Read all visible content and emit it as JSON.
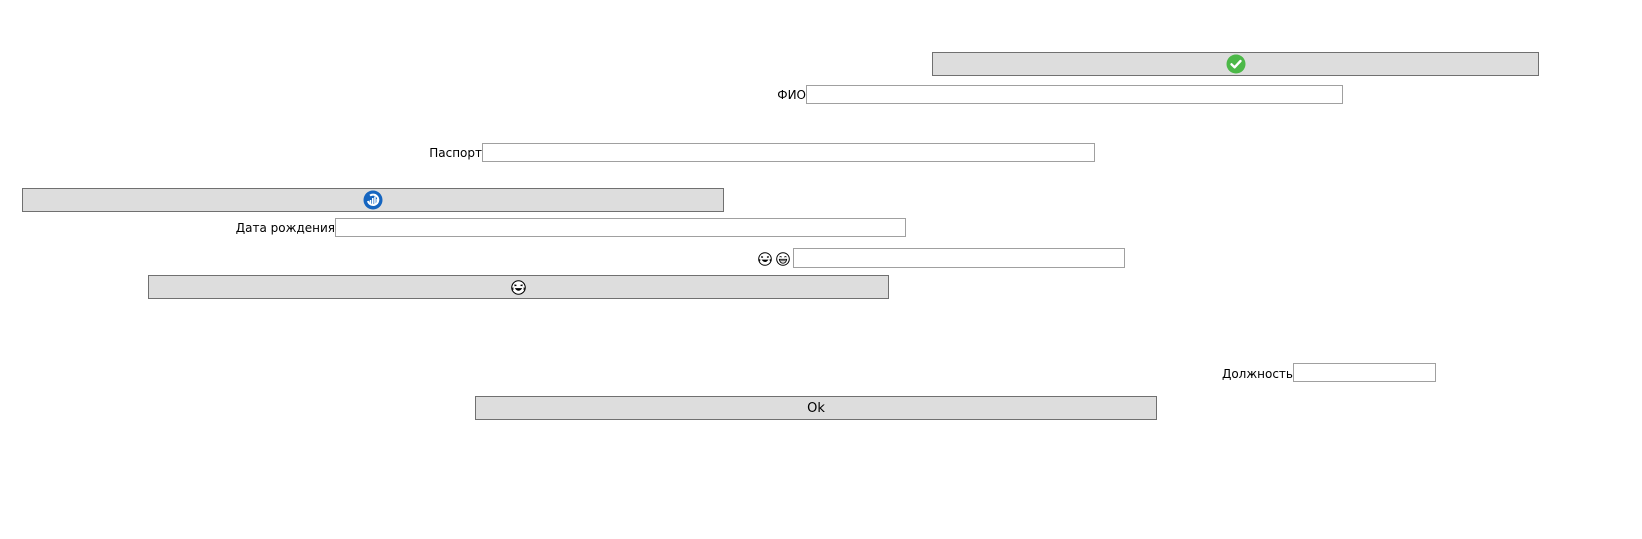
{
  "form": {
    "top_button": {
      "icon": "check-circle-icon",
      "icon_color": "#4cb848"
    },
    "fio": {
      "label": "ФИО",
      "value": ""
    },
    "passport": {
      "label": "Паспорт",
      "value": ""
    },
    "middle_button": {
      "icon": "refresh-circle-icon",
      "icon_color": "#1565c0"
    },
    "birth_date": {
      "label": "Дата рождения",
      "value": ""
    },
    "emoji_field": {
      "label_icons": [
        "laughing-face-icon",
        "grinning-face-icon"
      ],
      "value": ""
    },
    "emoji_button": {
      "icon": "laughing-face-icon"
    },
    "position": {
      "label": "Должность",
      "value": ""
    },
    "ok_button": {
      "label": "Ok"
    }
  }
}
